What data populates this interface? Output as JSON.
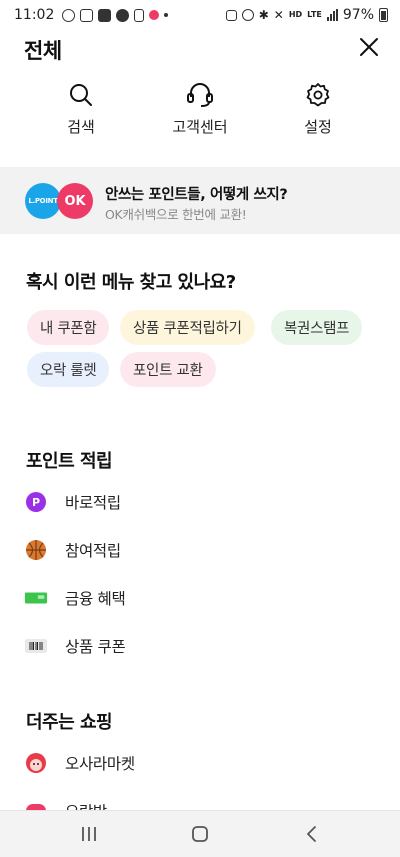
{
  "status_bar": {
    "time": "11:02",
    "left_icons": [
      "talk-icon",
      "messenger-icon",
      "ok-app-icon",
      "gear-icon",
      "file-icon",
      "bell-icon"
    ],
    "right_icons": [
      "alarm-icon",
      "nfc-icon",
      "bluetooth-icon",
      "mute-icon",
      "hd-voice-icon",
      "lte-icon",
      "signal-icon"
    ],
    "hd_label": "HD",
    "lte_label": "LTE",
    "battery": "97%"
  },
  "header": {
    "title": "전체"
  },
  "quick_actions": [
    {
      "label": "검색",
      "icon": "search-icon"
    },
    {
      "label": "고객센터",
      "icon": "headset-icon"
    },
    {
      "label": "설정",
      "icon": "gear-icon"
    }
  ],
  "banner": {
    "badge_lpoint": "L.POINT",
    "badge_ok": "OK",
    "title": "안쓰는 포인트들, 어떻게 쓰지?",
    "subtitle": "OK캐쉬백으로 한번에 교환!"
  },
  "suggested": {
    "title": "혹시 이런 메뉴 찾고 있나요?",
    "chips": [
      {
        "label": "내 쿠폰함",
        "color": "#fde8ee"
      },
      {
        "label": "상품 쿠폰적립하기",
        "color": "#fdf6dc"
      },
      {
        "label": "복권스탬프",
        "color": "#e8f6ea"
      },
      {
        "label": "오락 룰렛",
        "color": "#e8effd"
      },
      {
        "label": "포인트 교환",
        "color": "#fde8ee"
      }
    ]
  },
  "point_section": {
    "title": "포인트 적립",
    "items": [
      {
        "label": "바로적립",
        "icon": "point-p-icon"
      },
      {
        "label": "참여적립",
        "icon": "basketball-icon"
      },
      {
        "label": "금융 혜택",
        "icon": "money-icon"
      },
      {
        "label": "상품 쿠폰",
        "icon": "barcode-icon"
      }
    ]
  },
  "shopping_section": {
    "title": "더주는 쇼핑",
    "items": [
      {
        "label": "오사라마켓",
        "icon": "character-icon"
      },
      {
        "label": "오락방",
        "icon": "game-icon"
      }
    ]
  },
  "colors": {
    "accent_pink": "#ee3a66",
    "lpoint_blue": "#19a5e8",
    "purple": "#9b31e6",
    "banner_bg": "#f2f2f3"
  }
}
